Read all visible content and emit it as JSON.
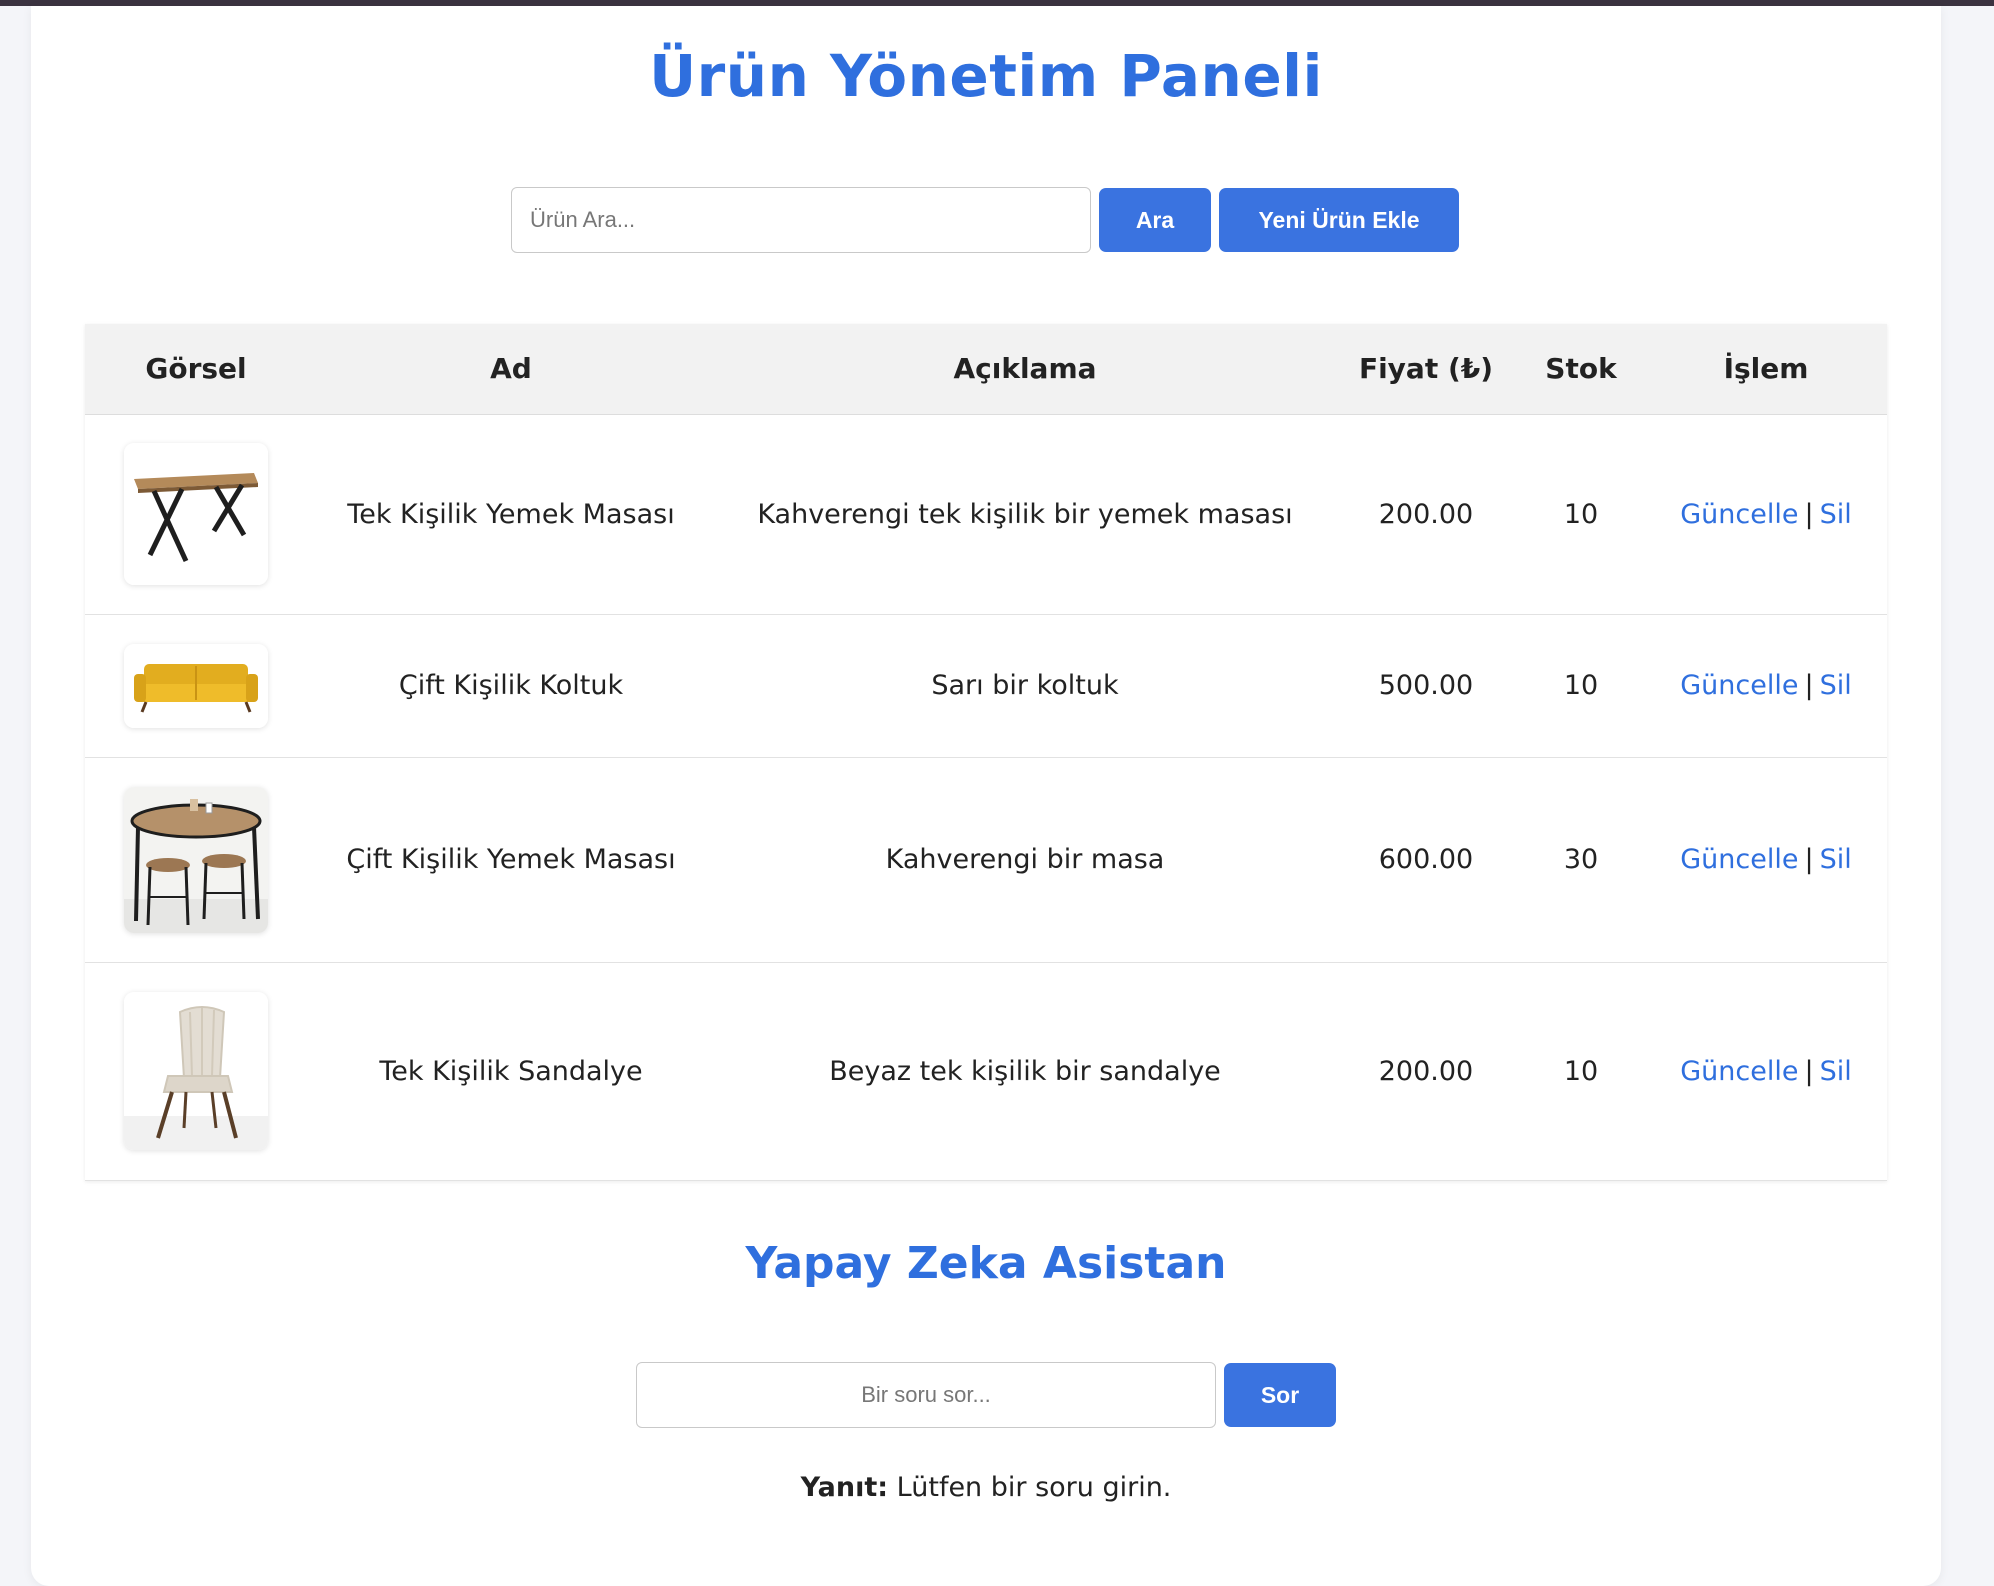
{
  "header": {
    "title": "Ürün Yönetim Paneli"
  },
  "search": {
    "placeholder": "Ürün Ara...",
    "search_button": "Ara",
    "add_button": "Yeni Ürün Ekle"
  },
  "table": {
    "columns": [
      "Görsel",
      "Ad",
      "Açıklama",
      "Fiyat (₺)",
      "Stok",
      "İşlem"
    ],
    "rows": [
      {
        "image": "dining-table-single",
        "name": "Tek Kişilik Yemek Masası",
        "description": "Kahverengi tek kişilik bir yemek masası",
        "price": "200.00",
        "stock": "10",
        "update": "Güncelle",
        "separator": "|",
        "delete": "Sil"
      },
      {
        "image": "yellow-sofa",
        "name": "Çift Kişilik Koltuk",
        "description": "Sarı bir koltuk",
        "price": "500.00",
        "stock": "10",
        "update": "Güncelle",
        "separator": "|",
        "delete": "Sil"
      },
      {
        "image": "dining-table-double",
        "name": "Çift Kişilik Yemek Masası",
        "description": "Kahverengi bir masa",
        "price": "600.00",
        "stock": "30",
        "update": "Güncelle",
        "separator": "|",
        "delete": "Sil"
      },
      {
        "image": "white-chair",
        "name": "Tek Kişilik Sandalye",
        "description": "Beyaz tek kişilik bir sandalye",
        "price": "200.00",
        "stock": "10",
        "update": "Güncelle",
        "separator": "|",
        "delete": "Sil"
      }
    ]
  },
  "assistant": {
    "title": "Yapay Zeka Asistan",
    "placeholder": "Bir soru sor...",
    "ask_button": "Sor",
    "answer_label": "Yanıt:",
    "answer_text": "Lütfen bir soru girin."
  },
  "colors": {
    "accent": "#3a73e0",
    "link": "#2f6fde",
    "header_bg": "#f2f2f2"
  }
}
